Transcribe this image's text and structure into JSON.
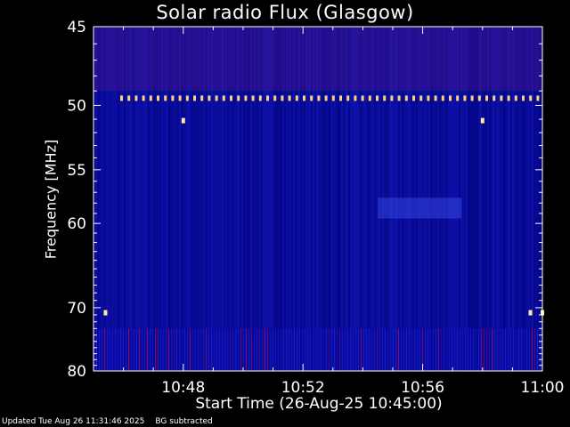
{
  "chart_data": {
    "type": "heatmap",
    "title": "Solar radio Flux (Glasgow)",
    "xlabel": "Start Time (26-Aug-25 10:45:00)",
    "ylabel": "Frequency [MHz]",
    "x_tick_labels": [
      "10:48",
      "10:52",
      "10:56",
      "11:00"
    ],
    "x_tick_minutes": [
      3,
      7,
      11,
      15
    ],
    "xlim_minutes": [
      0,
      15
    ],
    "y_ticks": [
      45,
      50,
      55,
      60,
      70,
      80
    ],
    "ylim": [
      45,
      80
    ],
    "y_scale": "reciprocal",
    "colorscale": [
      "#00007a",
      "#1a23d8",
      "#c0103c",
      "#ffffff"
    ],
    "features": {
      "interference_line_mhz": 49.5,
      "spike_points": [
        {
          "minute": 3.0,
          "mhz": 51.1
        },
        {
          "minute": 13.0,
          "mhz": 51.1
        },
        {
          "minute": 0.4,
          "mhz": 70.7
        },
        {
          "minute": 14.6,
          "mhz": 70.7
        },
        {
          "minute": 15.0,
          "mhz": 70.7
        }
      ],
      "faint_burst_region": {
        "minute_start": 9.5,
        "minute_end": 12.3,
        "mhz_low": 57.5,
        "mhz_high": 59.5
      }
    }
  },
  "footer": {
    "updated": "Updated Tue Aug 26 11:31:46 2025",
    "mode": "BG subtracted"
  }
}
